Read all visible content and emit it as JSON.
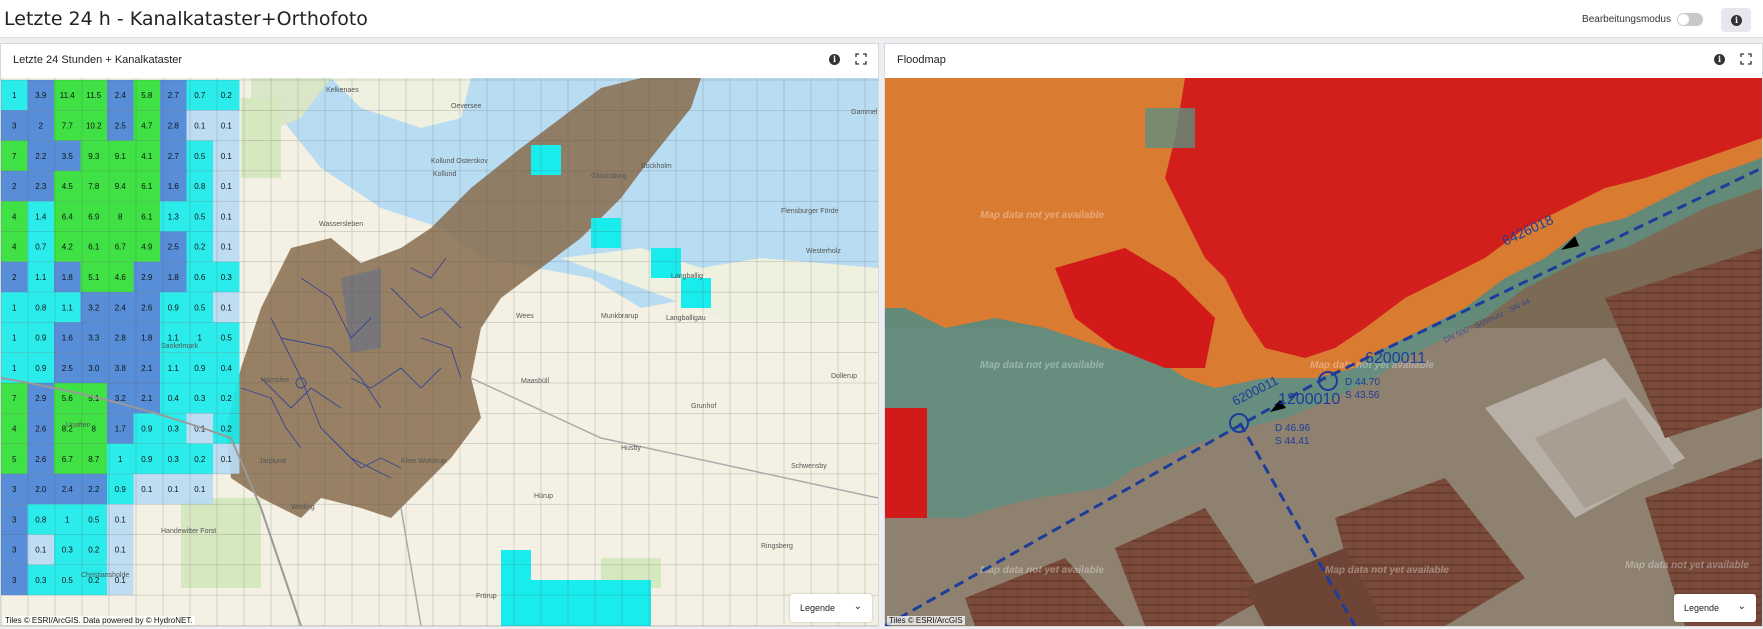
{
  "header": {
    "title": "Letzte 24 h - Kanalkataster+Orthofoto",
    "edit_mode_label": "Bearbeitungsmodus"
  },
  "panels": [
    {
      "title": "Letzte 24 Stunden + Kanalkataster",
      "attribution": "Tiles © ESRI/ArcGIS. Data powered by © HydroNET.",
      "legend_label": "Legende",
      "rain_columns": [
        [
          "1",
          "3",
          "7",
          "2",
          "4",
          "4",
          "2",
          "1",
          "1",
          "1",
          "7",
          "4",
          "5",
          "3",
          "3",
          "3",
          "3"
        ],
        [
          "3.9",
          "2",
          "2.2",
          "2.3",
          "1.4",
          "0.7",
          "1.1",
          "0.8",
          "0.9",
          "0.9",
          "2.9",
          "2.6",
          "2.6",
          "2.0",
          "0.8",
          "0.1",
          "0.3"
        ],
        [
          "11.4",
          "7.7",
          "3.5",
          "4.5",
          "6.4",
          "4.2",
          "1.8",
          "1.1",
          "1.6",
          "2.5",
          "5.6",
          "8.2",
          "6.7",
          "2.4",
          "1",
          "0.3",
          "0.5"
        ],
        [
          "11.5",
          "10.2",
          "9.3",
          "7.8",
          "6.9",
          "6.1",
          "5.1",
          "3.2",
          "3.3",
          "3.0",
          "5.1",
          "8",
          "8.7",
          "2.2",
          "0.5",
          "0.2",
          "0.2"
        ],
        [
          "2.4",
          "2.5",
          "9.1",
          "9.4",
          "8",
          "6.7",
          "4.6",
          "2.4",
          "2.8",
          "3.8",
          "3.2",
          "1.7",
          "1",
          "0.9",
          "0.1",
          "0.1",
          "0.1"
        ],
        [
          "5.8",
          "4.7",
          "4.1",
          "6.1",
          "6.1",
          "4.9",
          "2.9",
          "2.6",
          "1.8",
          "2.1",
          "2.1",
          "0.9",
          "0.9",
          "0.1",
          "",
          "",
          ""
        ],
        [
          "2.7",
          "2.8",
          "2.7",
          "1.6",
          "1.3",
          "2.5",
          "1.8",
          "0.9",
          "1.1",
          "1.1",
          "0.4",
          "0.3",
          "0.3",
          "0.1",
          "",
          "",
          ""
        ],
        [
          "0.7",
          "0.1",
          "0.5",
          "0.8",
          "0.5",
          "0.2",
          "0.6",
          "0.5",
          "1",
          "0.9",
          "0.3",
          "0.1",
          "0.2",
          "0.1",
          "",
          "",
          ""
        ],
        [
          "0.2",
          "0.1",
          "0.1",
          "0.1",
          "0.1",
          "0.1",
          "0.3",
          "0.1",
          "0.5",
          "0.4",
          "0.2",
          "0.2",
          "0.1",
          "",
          "",
          "",
          ""
        ]
      ],
      "place_names": [
        "Kelkenaes",
        "Kollund Osterskov",
        "Kollund",
        "Bockholm",
        "Wassersleben",
        "Westerholz",
        "Langballig",
        "Munkbrarup",
        "Maasbüll",
        "Grunhof",
        "Husby",
        "Hürup",
        "Weding",
        "Klein Wolstrup",
        "Handewitter Forst",
        "Jarplund",
        "Christiansholde",
        "Frörup",
        "Harrislee",
        "Flensburger Förde",
        "Gammel",
        "Dollerup",
        "Schwensby",
        "Ringsberg",
        "Wees",
        "Langballigau",
        "Unaften",
        "Sankelmark",
        "Oeversee",
        "Glücksburg"
      ]
    },
    {
      "title": "Floodmap",
      "attribution": "Tiles © ESRI/ArcGIS",
      "legend_label": "Legende",
      "watermark": "Map data not yet available",
      "pipe_labels": [
        "6426018",
        "6200011",
        "6200011",
        "1200010",
        "D 44.70",
        "S 43.56",
        "D 46.96",
        "S 44.41",
        "DN 500 - Schmutz - SN 44"
      ]
    }
  ],
  "icons": {
    "info": "info-icon",
    "expand": "expand-icon",
    "chevron": "chevron-down-icon"
  },
  "colors": {
    "accent": "#6a3fa0",
    "rain_high": "#2fe036",
    "rain_mid": "#4a86d6",
    "rain_low": "#19ecec",
    "rain_min": "#b9dbf4",
    "pipe": "#1d3d9a",
    "flood_high": "#d01a1a",
    "flood_mid": "#e0702a"
  }
}
